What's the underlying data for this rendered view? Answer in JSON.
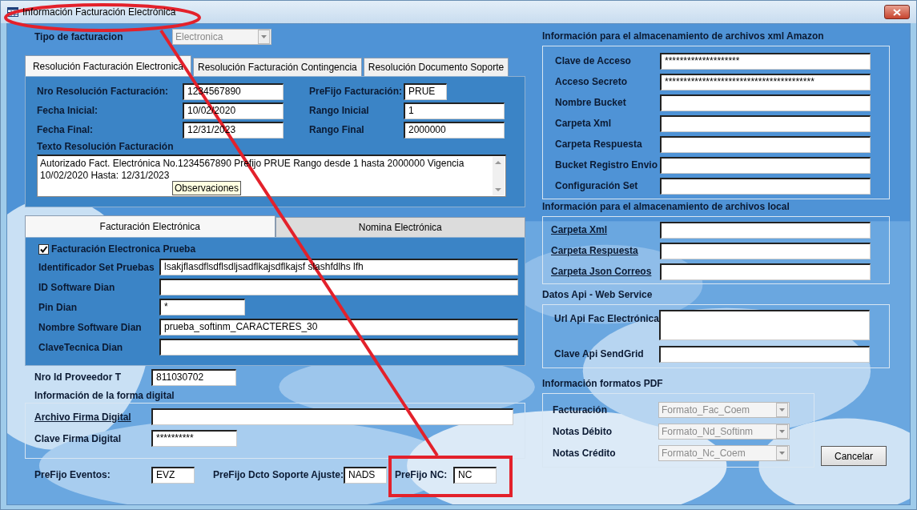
{
  "window": {
    "title": "Información Facturación Electrónica"
  },
  "billing_type": {
    "label": "Tipo de facturacion",
    "value": "Electronica",
    "disabled": true
  },
  "resolution_tabs": [
    {
      "label": "Resolución Facturación Electronica",
      "selected": true
    },
    {
      "label": "Resolución Facturación Contingencia",
      "selected": false
    },
    {
      "label": "Resolución Documento Soporte",
      "selected": false
    }
  ],
  "resolution": {
    "left_fields": [
      {
        "label": "Nro Resolución Facturación:",
        "value": "1234567890"
      },
      {
        "label": "Fecha Inicial:",
        "value": "10/02/2020"
      },
      {
        "label": "Fecha Final:",
        "value": "12/31/2023"
      }
    ],
    "right_fields": [
      {
        "label": "PreFijo Facturación:",
        "value": "PRUE"
      },
      {
        "label": "Rango Inicial",
        "value": "1"
      },
      {
        "label": "Rango Final",
        "value": "2000000"
      }
    ],
    "text_label": "Texto Resolución Facturación",
    "text_value": "Autorizado Fact. Electrónica No.1234567890 Prefijo PRUE Rango desde 1 hasta 2000000 Vigencia 10/02/2020 Hasta: 12/31/2023",
    "tooltip": "Observaciones"
  },
  "dian_tabs": [
    {
      "label": "Facturación Electrónica",
      "selected": true
    },
    {
      "label": "Nomina Electrónica",
      "selected": false
    }
  ],
  "test_mode": {
    "label": "Facturación Electronica Prueba",
    "checked": true
  },
  "dian_fields": [
    {
      "label": "Identificador Set Pruebas",
      "value": "lsakjflasdflsdflsdljsadflkajsdflkajsf slashfdlhs lfh"
    },
    {
      "label": "ID Software Dian"
    },
    {
      "label": "Pin Dian",
      "value": "*"
    },
    {
      "label": "Nombre Software Dian",
      "value": "prueba_softinm_CARACTERES_30"
    },
    {
      "label": "ClaveTecnica Dian"
    }
  ],
  "provider": {
    "label": "Nro Id Proveedor T",
    "value": "811030702"
  },
  "signature": {
    "title": "Información de la forma digital",
    "fields": [
      {
        "label": "Archivo Firma Digital",
        "kind": "link"
      },
      {
        "label": "Clave Firma Digital",
        "kind": "text",
        "value": "**********"
      }
    ]
  },
  "prefixes": [
    {
      "label": "PreFijo Eventos:",
      "value": "EVZ"
    },
    {
      "label": "PreFijo Dcto Soporte Ajuste:",
      "value": "NADS"
    },
    {
      "label": "PreFijo NC:",
      "value": "NC"
    }
  ],
  "amazon": {
    "title": "Información para el almacenamiento de archivos xml Amazon",
    "fields": [
      {
        "label": "Clave de Acceso",
        "value": "********************"
      },
      {
        "label": "Acceso Secreto",
        "value": "****************************************"
      },
      {
        "label": "Nombre Bucket"
      },
      {
        "label": "Carpeta Xml"
      },
      {
        "label": "Carpeta Respuesta"
      },
      {
        "label": "Bucket Registro Envio"
      },
      {
        "label": "Configuración Set"
      }
    ]
  },
  "local": {
    "title": "Información para el almacenamiento de archivos local",
    "fields": [
      {
        "label": "Carpeta Xml",
        "kind": "link"
      },
      {
        "label": "Carpeta Respuesta",
        "kind": "link"
      },
      {
        "label": "Carpeta Json Correos",
        "kind": "link"
      }
    ]
  },
  "api": {
    "title": "Datos Api - Web Service",
    "fields": [
      {
        "label": "Url Api Fac Electrónica",
        "kind": "multiline"
      },
      {
        "label": "Clave Api SendGrid",
        "kind": "single"
      }
    ]
  },
  "pdf": {
    "title": "Información formatos PDF",
    "fields": [
      {
        "label": "Facturación",
        "value": "Formato_Fac_Coem",
        "disabled": true
      },
      {
        "label": "Notas Débito",
        "value": "Formato_Nd_Softinm",
        "disabled": true
      },
      {
        "label": "Notas Crédito",
        "value": "Formato_Nc_Coem",
        "disabled": true
      }
    ]
  },
  "cancel_button": "Cancelar"
}
